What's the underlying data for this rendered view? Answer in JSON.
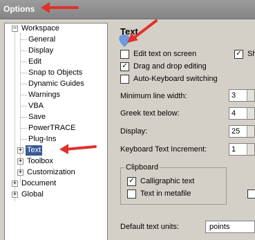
{
  "window": {
    "title": "Options"
  },
  "tree": {
    "workspace": "Workspace",
    "children": [
      "General",
      "Display",
      "Edit",
      "Snap to Objects",
      "Dynamic Guides",
      "Warnings",
      "VBA",
      "Save",
      "PowerTRACE",
      "Plug-Ins"
    ],
    "expandable": [
      "Text",
      "Toolbox",
      "Customization"
    ],
    "document": "Document",
    "global": "Global"
  },
  "panel": {
    "title": "Text",
    "checks": {
      "edit_text_on_screen": {
        "label": "Edit text on screen",
        "checked": false
      },
      "drag_drop": {
        "label": "Drag and drop editing",
        "checked": true
      },
      "auto_keyboard": {
        "label": "Auto-Keyboard switching",
        "checked": false
      },
      "show_partial": {
        "label": "Sho",
        "checked": true
      }
    },
    "fields": {
      "min_line_width": {
        "label": "Minimum line width:",
        "value": "3"
      },
      "greek_text_below": {
        "label": "Greek text below:",
        "value": "4"
      },
      "display": {
        "label": "Display:",
        "value": "25"
      },
      "keyboard_increment": {
        "label": "Keyboard Text Increment:",
        "value": "1"
      }
    },
    "clipboard": {
      "label": "Clipboard",
      "calligraphic": {
        "label": "Calligraphic text",
        "checked": true
      },
      "metafile": {
        "label": "Text in metafile",
        "checked": false
      }
    },
    "default_units": {
      "label": "Default text units:",
      "value": "points"
    }
  },
  "colors": {
    "arrow": "#e0312c",
    "cursor": "#5b8fe0",
    "selection": "#3b5998"
  }
}
